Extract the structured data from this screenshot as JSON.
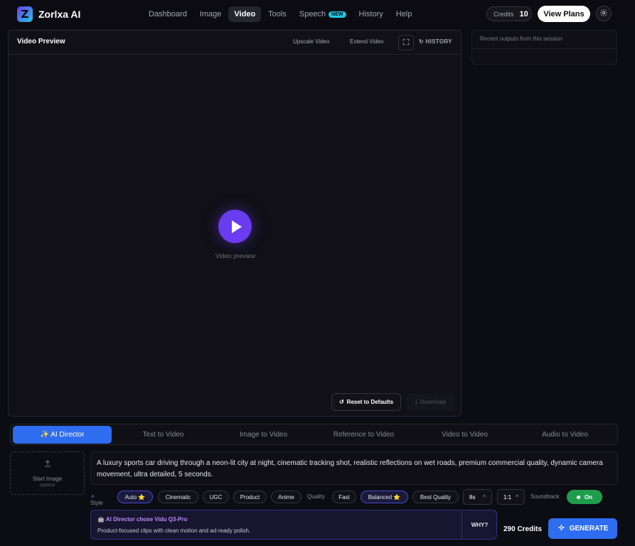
{
  "app": {
    "title": "Zorlxa AI",
    "logo_letter": "Z"
  },
  "nav": [
    {
      "label": "Dashboard"
    },
    {
      "label": "Image"
    },
    {
      "label": "Video",
      "active": true
    },
    {
      "label": "Tools"
    },
    {
      "label": "Speech",
      "badge": "NEW"
    },
    {
      "label": "History"
    },
    {
      "label": "Help"
    }
  ],
  "header": {
    "credits_label": "Credits",
    "credits_value": "10",
    "plans_label": "View Plans",
    "settings_icon": "gear-icon"
  },
  "preview": {
    "title": "Video Preview",
    "upscale_label": "Upscale Video",
    "extend_label": "Extend Video",
    "history_label": "HISTORY",
    "caption": "Video preview",
    "reset_label": "Reset to Defaults",
    "download_label": "Download"
  },
  "right_panel": {
    "text": "Recent outputs from this session"
  },
  "tabs": [
    {
      "label": "✨ AI Director",
      "active": true
    },
    {
      "label": "Text to Video"
    },
    {
      "label": "Image to Video"
    },
    {
      "label": "Reference to Video"
    },
    {
      "label": "Video to Video"
    },
    {
      "label": "Audio to Video"
    }
  ],
  "start_image": {
    "label": "Start Image",
    "sub": "optional"
  },
  "prompt": {
    "text": "A luxury sports car driving through a neon-lit city at night, cinematic tracking shot, realistic reflections on wet roads, premium commercial quality, dynamic camera movement, ultra detailed, 5 seconds."
  },
  "controls": {
    "style_label": "Style",
    "styles": [
      "Auto ⭐",
      "Cinematic",
      "UGC",
      "Product",
      "Anime"
    ],
    "style_selected": "Auto ⭐",
    "quality_label": "Quality",
    "qualities": [
      "Fast",
      "Balanced ⭐",
      "Best Quality"
    ],
    "quality_selected": "Balanced ⭐",
    "duration": "8s",
    "aspect": "1:1",
    "soundtrack_label": "Soundtrack",
    "soundtrack_value": "On"
  },
  "director": {
    "title": "AI Director chose Vidu Q3-Pro",
    "desc": "Product-focused clips with clean motion and ad-ready polish.",
    "why_label": "WHY?"
  },
  "footer": {
    "total_credits": "290 Credits",
    "generate_label": "GENERATE"
  },
  "colors": {
    "accent": "#2f6df0",
    "play": "#6a3cf0",
    "toggle_on": "#1e9e4c",
    "new_badge": "#1ec8e6"
  }
}
